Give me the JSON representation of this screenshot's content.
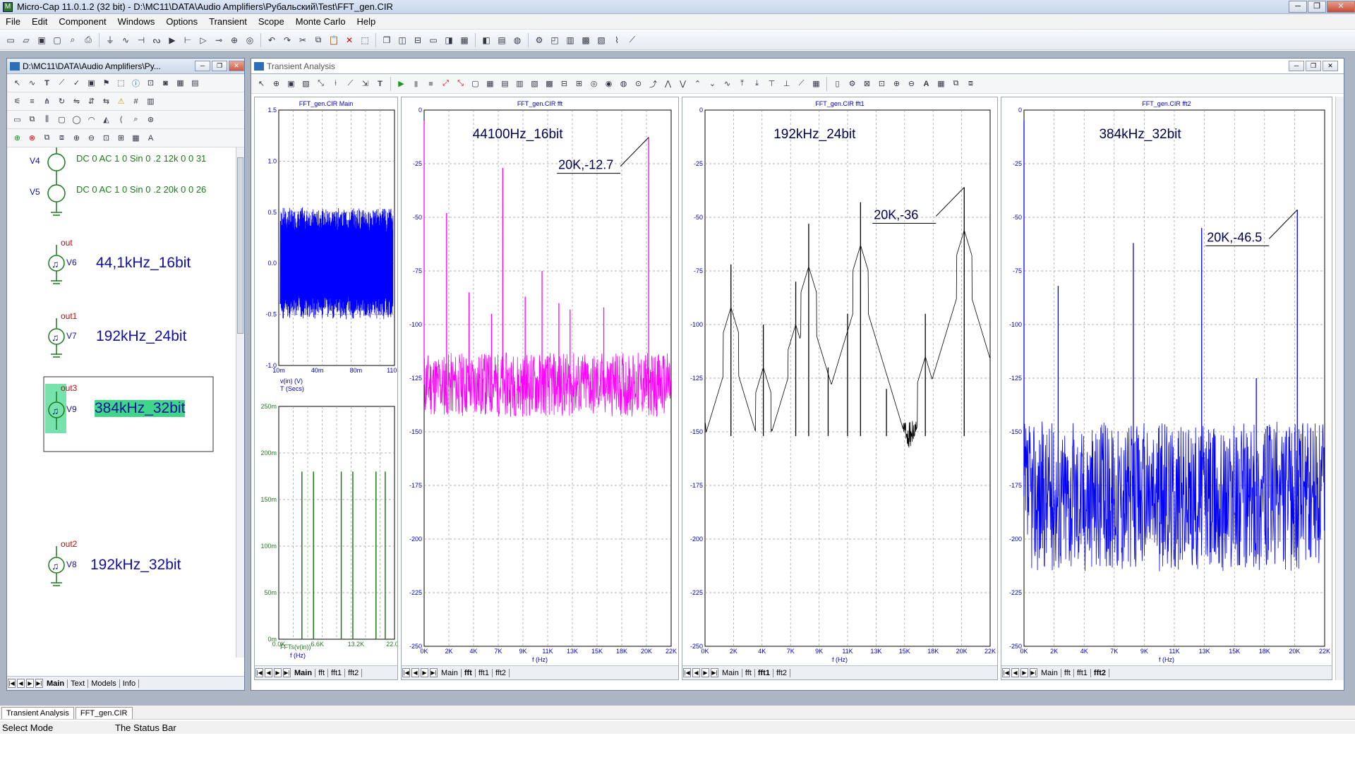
{
  "window": {
    "title": "Micro-Cap 11.0.1.2 (32 bit) - D:\\MC11\\DATA\\Audio Amplifiers\\Рубальский\\Test\\FFT_gen.CIR",
    "controls": [
      "─",
      "❐",
      "✕"
    ]
  },
  "menu": [
    "File",
    "Edit",
    "Component",
    "Windows",
    "Options",
    "Transient",
    "Scope",
    "Monte Carlo",
    "Help"
  ],
  "schematic": {
    "title": "D:\\MC11\\DATA\\Audio Amplifiers\\Py...",
    "components": [
      {
        "name": "V4",
        "value": "DC 0 AC 1 0 Sin 0 .2 12k 0 0 31"
      },
      {
        "name": "V5",
        "value": "DC 0 AC 1 0 Sin 0 .2 20k 0 0 26"
      },
      {
        "name": "V6",
        "node": "out",
        "label": "44,1kHz_16bit"
      },
      {
        "name": "V7",
        "node": "out1",
        "label": "192kHz_24bit"
      },
      {
        "name": "V9",
        "node": "out3",
        "label": "384kHz_32bit"
      },
      {
        "name": "V8",
        "node": "out2",
        "label": "192kHz_32bit"
      }
    ],
    "tabs": [
      "Main",
      "Text",
      "Models",
      "Info"
    ],
    "active_tab": "Main"
  },
  "analysis": {
    "title": "Transient Analysis",
    "panels": [
      {
        "title": "FFT_gen.CIR Main",
        "tabs": [
          "Main",
          "fft",
          "fft1",
          "fft2"
        ],
        "active": "Main"
      },
      {
        "title": "FFT_gen.CIR fft",
        "tabs": [
          "Main",
          "fft",
          "fft1",
          "fft2"
        ],
        "active": "fft"
      },
      {
        "title": "FFT_gen.CIR fft1",
        "tabs": [
          "Main",
          "fft",
          "fft1",
          "fft2"
        ],
        "active": "fft1"
      },
      {
        "title": "FFT_gen.CIR fft2",
        "tabs": [
          "Main",
          "fft",
          "fft1",
          "fft2"
        ],
        "active": "fft2"
      }
    ]
  },
  "chart_data": [
    {
      "type": "line",
      "title": "FFT_gen.CIR Main",
      "xlabel": "T (Secs)",
      "ylabel": "v(in) (V)",
      "x_ticks": [
        "10m",
        "40m",
        "80m",
        "110m"
      ],
      "y_ticks": [
        "1.5",
        "1.0",
        "0.5",
        "0.0",
        "-0.5",
        "-1.0"
      ],
      "ylim": [
        -1.0,
        1.5
      ],
      "color": "#0000ff"
    },
    {
      "type": "bar",
      "title": "",
      "xlabel": "f (Hz)",
      "ylabel": "FFTs(v(in))",
      "x_ticks": [
        "0.0K",
        "6.6K",
        "13.2K",
        "22.0K"
      ],
      "y_ticks": [
        "250m",
        "200m",
        "150m",
        "100m",
        "50m",
        "0m"
      ],
      "ylim": [
        0,
        0.25
      ],
      "color": "#1f7a1f",
      "x": [
        0.2,
        0.3,
        0.54,
        0.64,
        0.84,
        0.92
      ],
      "values": [
        0.18,
        0.18,
        0.18,
        0.18,
        0.18,
        0.18
      ]
    },
    {
      "type": "line",
      "title": "FFT_gen.CIR fft",
      "annotation_title": "44100Hz_16bit",
      "annotation": "20K,-12.7",
      "xlabel": "f (Hz)",
      "x_ticks": [
        "0K",
        "2K",
        "4K",
        "7K",
        "9K",
        "11K",
        "13K",
        "15K",
        "18K",
        "20K",
        "22K"
      ],
      "y_ticks": [
        "0",
        "-25",
        "-50",
        "-75",
        "-100",
        "-125",
        "-150",
        "-175",
        "-200",
        "-225",
        "-250"
      ],
      "ylim": [
        -250,
        0
      ],
      "color": "#ff00ff",
      "noise_floor": -128,
      "peaks": [
        [
          0,
          -5
        ],
        [
          2000,
          -48
        ],
        [
          4000,
          -85
        ],
        [
          6000,
          -95
        ],
        [
          7000,
          -27
        ],
        [
          9000,
          -87
        ],
        [
          10500,
          -75
        ],
        [
          12000,
          -90
        ],
        [
          13000,
          -93
        ],
        [
          16000,
          -92
        ],
        [
          20000,
          -12.7
        ]
      ]
    },
    {
      "type": "line",
      "title": "FFT_gen.CIR fft1",
      "annotation_title": "192kHz_24bit",
      "annotation": "20K,-36",
      "xlabel": "f (Hz)",
      "x_ticks": [
        "0K",
        "2K",
        "4K",
        "7K",
        "9K",
        "11K",
        "13K",
        "15K",
        "18K",
        "20K",
        "22K"
      ],
      "y_ticks": [
        "0",
        "-25",
        "-50",
        "-75",
        "-100",
        "-125",
        "-150",
        "-175",
        "-200",
        "-225",
        "-250"
      ],
      "ylim": [
        -250,
        0
      ],
      "color": "#000000",
      "noise_floor": -152,
      "peaks": [
        [
          2000,
          -72
        ],
        [
          4500,
          -100
        ],
        [
          7000,
          -80
        ],
        [
          8000,
          -53
        ],
        [
          9500,
          -120
        ],
        [
          11000,
          -95
        ],
        [
          12000,
          -43
        ],
        [
          14000,
          -130
        ],
        [
          17000,
          -95
        ],
        [
          20000,
          -36
        ]
      ]
    },
    {
      "type": "line",
      "title": "FFT_gen.CIR fft2",
      "annotation_title": "384kHz_32bit",
      "annotation": "20K,-46.5",
      "xlabel": "f (Hz)",
      "x_ticks": [
        "0K",
        "2K",
        "4K",
        "7K",
        "9K",
        "11K",
        "13K",
        "15K",
        "18K",
        "20K",
        "22K"
      ],
      "y_ticks": [
        "0",
        "-25",
        "-50",
        "-75",
        "-100",
        "-125",
        "-150",
        "-175",
        "-200",
        "-225",
        "-250"
      ],
      "ylim": [
        -250,
        0
      ],
      "color": "#0000ff",
      "noise_floor": -180,
      "peaks": [
        [
          0,
          -5
        ],
        [
          2500,
          -82
        ],
        [
          8000,
          -62
        ],
        [
          13000,
          -55
        ],
        [
          17000,
          -125
        ],
        [
          20000,
          -46.5
        ]
      ]
    }
  ],
  "bottom_tabs": [
    "Transient Analysis",
    "FFT_gen.CIR"
  ],
  "status": {
    "mode": "Select Mode",
    "message": "The Status Bar"
  }
}
